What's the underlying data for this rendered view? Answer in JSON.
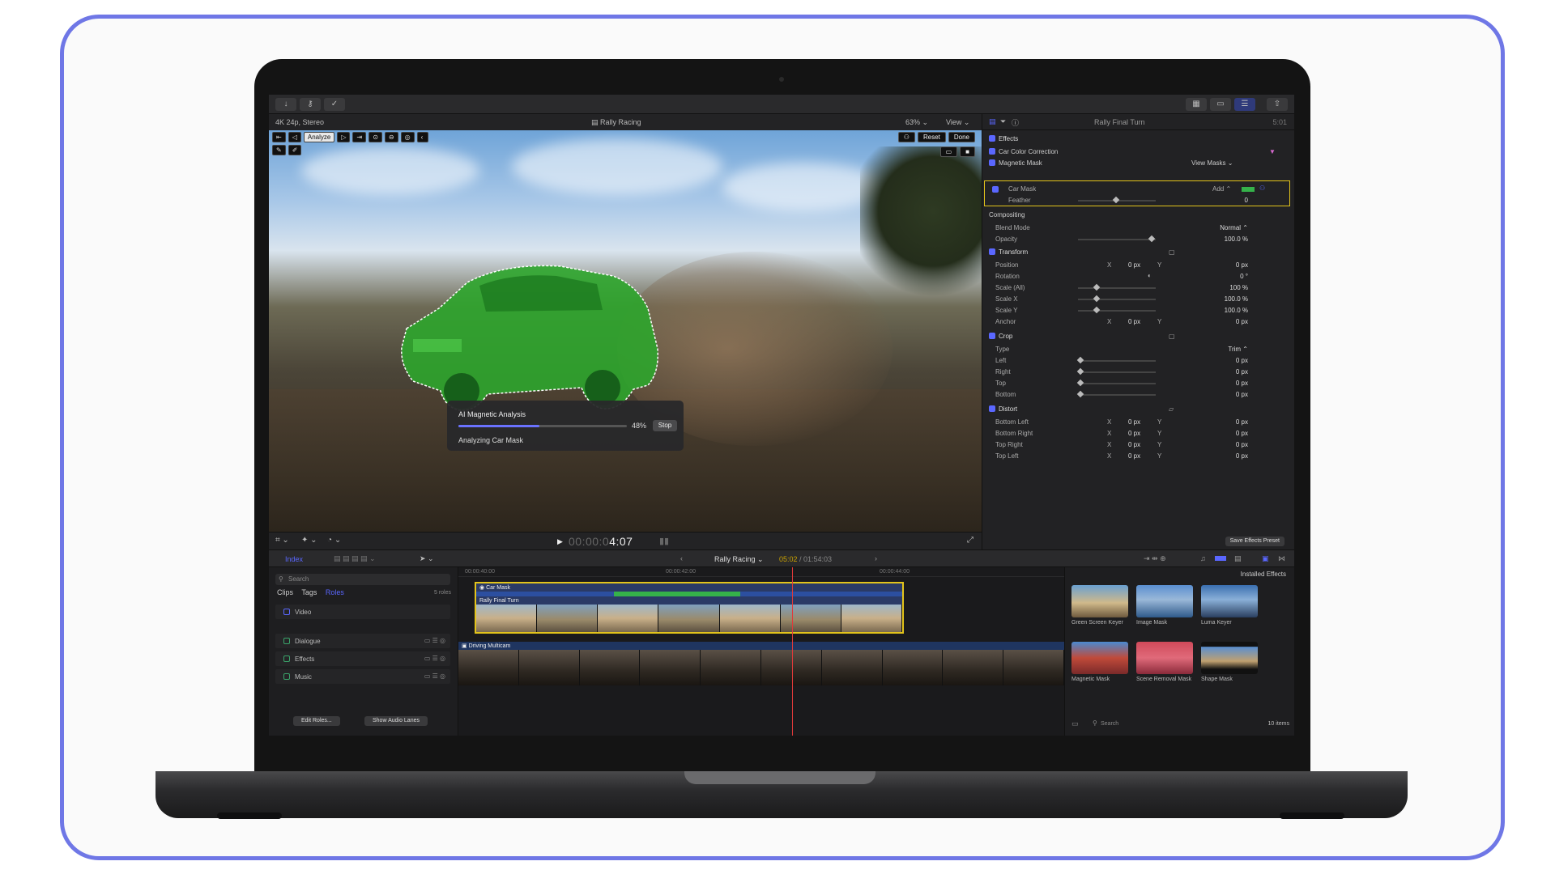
{
  "viewer": {
    "format": "4K 24p, Stereo",
    "project": "Rally Racing",
    "zoom": "63% ⌄",
    "view": "View ⌄",
    "tools": {
      "analyze": "Analyze"
    },
    "buttons": {
      "reset": "Reset",
      "done": "Done"
    },
    "analysis": {
      "title": "AI Magnetic Analysis",
      "percent_text": "48%",
      "progress": 0.48,
      "stop": "Stop",
      "status": "Analyzing Car Mask"
    },
    "timecode_dim": "00:00:0",
    "timecode": "4:07"
  },
  "inspector": {
    "title": "Rally Final Turn",
    "time": "5:01",
    "effects": "Effects",
    "car_color_correction": "Car Color Correction",
    "magnetic_mask": "Magnetic Mask",
    "view_masks": "View Masks ⌄",
    "car_mask": "Car Mask",
    "add": "Add ⌃",
    "feather": "Feather",
    "feather_value": "0",
    "compositing": "Compositing",
    "blend_mode": "Blend Mode",
    "blend_mode_value": "Normal ⌃",
    "opacity": "Opacity",
    "opacity_value": "100.0 %",
    "transform": "Transform",
    "position": "Position",
    "rotation": "Rotation",
    "rotation_value": "0 °",
    "scale_all": "Scale (All)",
    "scale_all_value": "100 %",
    "scale_x": "Scale X",
    "scale_x_value": "100.0 %",
    "scale_y": "Scale Y",
    "scale_y_value": "100.0 %",
    "anchor": "Anchor",
    "crop": "Crop",
    "type": "Type",
    "type_value": "Trim ⌃",
    "left": "Left",
    "right": "Right",
    "top": "Top",
    "bottom": "Bottom",
    "distort": "Distort",
    "bottom_left": "Bottom Left",
    "bottom_right": "Bottom Right",
    "top_right": "Top Right",
    "top_left": "Top Left",
    "x": "X",
    "y": "Y",
    "zero_px": "0 px",
    "save_preset": "Save Effects Preset"
  },
  "timeline_header": {
    "index": "Index",
    "project": "Rally Racing ⌄",
    "duration_current": "05:02",
    "duration_total": " / 01:54:03"
  },
  "index_panel": {
    "search": "Search",
    "tab_clips": "Clips",
    "tab_tags": "Tags",
    "tab_roles": "Roles",
    "roles_count": "5 roles",
    "roles": [
      "Video",
      "Dialogue",
      "Effects",
      "Music"
    ],
    "edit_roles": "Edit Roles...",
    "show_audio_lanes": "Show Audio Lanes"
  },
  "timeline": {
    "ruler": [
      "00:00:40:00",
      "00:00:42:00",
      "00:00:44:00"
    ],
    "mask_label": "Car Mask",
    "clip_name": "Rally Final Turn",
    "secondary_clip": "Driving Multicam"
  },
  "effects_panel": {
    "title": "Installed Effects",
    "items": [
      "Green Screen Keyer",
      "Image Mask",
      "Luma Keyer",
      "Magnetic Mask",
      "Scene Removal Mask",
      "Shape Mask"
    ],
    "search": "Search",
    "count": "10 items"
  },
  "colors": {
    "accent": "#5a67ff",
    "selection": "#e3c41b",
    "mask_green": "#35b24a",
    "playhead": "#e03a3a",
    "frame": "#6f77e6"
  }
}
